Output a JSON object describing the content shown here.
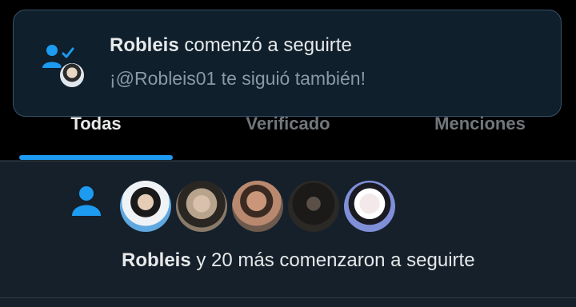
{
  "colors": {
    "accent": "#1d9bf0",
    "background": "#15202b",
    "text_primary": "#e7e9ea",
    "text_secondary": "#8b98a5"
  },
  "toast": {
    "icon": "person-check-icon",
    "user": "Robleis",
    "action": "comenzó a seguirte",
    "subtitle": "¡@Robleis01 te siguió también!"
  },
  "tabs": [
    {
      "label": "Todas",
      "active": true
    },
    {
      "label": "Verificado",
      "active": false
    },
    {
      "label": "Menciones",
      "active": false
    }
  ],
  "notification": {
    "icon": "person-icon",
    "user": "Robleis",
    "text": "y 20 más comenzaron a seguirte",
    "avatars": [
      "avatar-1",
      "avatar-2",
      "avatar-3",
      "avatar-4",
      "avatar-5"
    ]
  }
}
